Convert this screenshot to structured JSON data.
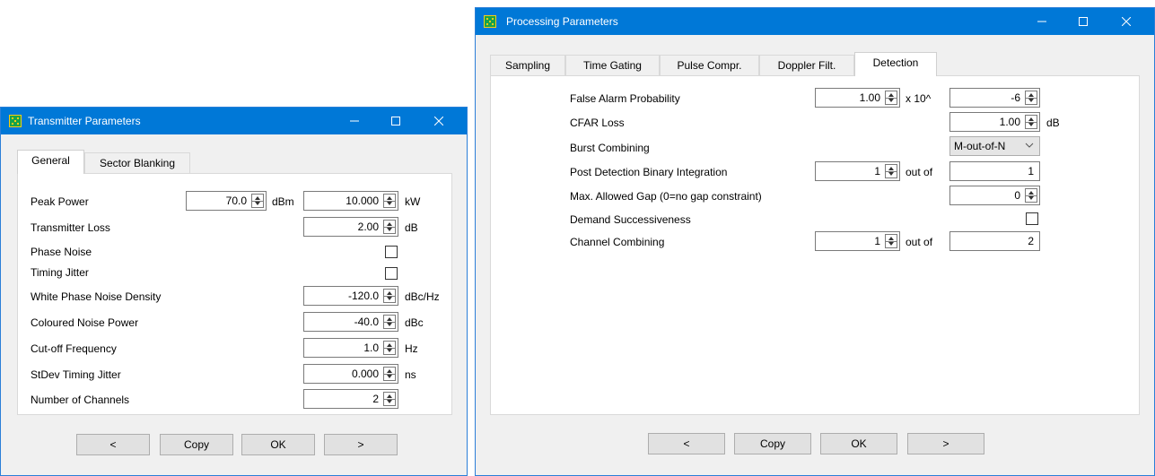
{
  "colors": {
    "titlebar": "#0078d7",
    "window_bg": "#f0f0f0",
    "panel_bg": "#ffffff"
  },
  "icons": [
    "app-icon",
    "minimize-icon",
    "maximize-icon",
    "close-icon",
    "spin-arrows-icon",
    "chevron-down-icon"
  ],
  "transmitter": {
    "title": "Transmitter Parameters",
    "tabs": [
      "General",
      "Sector Blanking"
    ],
    "active_tab": "General",
    "fields": {
      "peak_power": {
        "label": "Peak Power",
        "dbm_value": "70.0",
        "dbm_unit": "dBm",
        "kw_value": "10.000",
        "kw_unit": "kW"
      },
      "transmitter_loss": {
        "label": "Transmitter Loss",
        "value": "2.00",
        "unit": "dB"
      },
      "phase_noise": {
        "label": "Phase Noise",
        "checked": false
      },
      "timing_jitter": {
        "label": "Timing Jitter",
        "checked": false
      },
      "white_phase_noise_density": {
        "label": "White Phase Noise Density",
        "value": "-120.0",
        "unit": "dBc/Hz"
      },
      "coloured_noise_power": {
        "label": "Coloured Noise Power",
        "value": "-40.0",
        "unit": "dBc"
      },
      "cutoff_frequency": {
        "label": "Cut-off Frequency",
        "value": "1.0",
        "unit": "Hz"
      },
      "stdev_timing_jitter": {
        "label": "StDev Timing Jitter",
        "value": "0.000",
        "unit": "ns"
      },
      "number_of_channels": {
        "label": "Number of Channels",
        "value": "2"
      }
    },
    "buttons": {
      "prev": "<",
      "copy": "Copy",
      "ok": "OK",
      "next": ">"
    }
  },
  "processing": {
    "title": "Processing Parameters",
    "tabs": [
      "Sampling",
      "Time Gating",
      "Pulse Compr.",
      "Doppler Filt.",
      "Detection"
    ],
    "active_tab": "Detection",
    "fields": {
      "false_alarm_probability": {
        "label": "False Alarm Probability",
        "mantissa": "1.00",
        "times": "x 10^",
        "exponent": "-6"
      },
      "cfar_loss": {
        "label": "CFAR Loss",
        "value": "1.00",
        "unit": "dB"
      },
      "burst_combining": {
        "label": "Burst Combining",
        "value": "M-out-of-N"
      },
      "post_detection": {
        "label": "Post Detection Binary Integration",
        "m": "1",
        "out_of": "out of",
        "n": "1"
      },
      "max_allowed_gap": {
        "label": "Max. Allowed Gap (0=no gap constraint)",
        "value": "0"
      },
      "demand_successiveness": {
        "label": "Demand Successiveness",
        "checked": false
      },
      "channel_combining": {
        "label": "Channel Combining",
        "m": "1",
        "out_of": "out of",
        "n": "2"
      }
    },
    "buttons": {
      "prev": "<",
      "copy": "Copy",
      "ok": "OK",
      "next": ">"
    }
  }
}
